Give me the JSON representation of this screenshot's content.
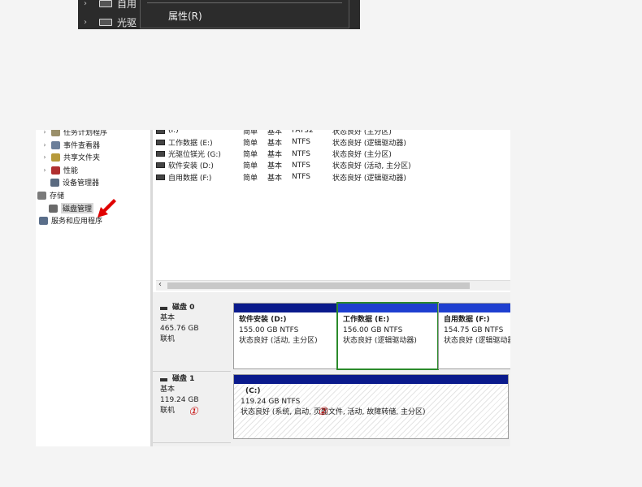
{
  "top_menu": {
    "tree_items": [
      "自用",
      "光驱"
    ],
    "context_menu_item": "属性(R)"
  },
  "nav": {
    "items": [
      {
        "label": "任务计划程序",
        "expander": "›",
        "icon_color": "#9a8f6a"
      },
      {
        "label": "事件查看器",
        "expander": "›",
        "icon_color": "#6b7f9a"
      },
      {
        "label": "共享文件夹",
        "expander": "›",
        "icon_color": "#b79a3a"
      },
      {
        "label": "性能",
        "expander": "›",
        "icon_color": "#b03030"
      },
      {
        "label": "设备管理器",
        "expander": "",
        "icon_color": "#5a6a80"
      },
      {
        "label": "存储",
        "expander": "",
        "icon_color": "#7a7a7a"
      },
      {
        "label": "磁盘管理",
        "expander": "",
        "icon_color": "#6a6a6a"
      },
      {
        "label": "服务和应用程序",
        "expander": "",
        "icon_color": "#5a6e8a"
      }
    ]
  },
  "volumes": [
    {
      "name": "(I:)",
      "layout": "简单",
      "type": "基本",
      "fs": "FAT32",
      "status": "状态良好 (主分区)"
    },
    {
      "name": "工作数据 (E:)",
      "layout": "简单",
      "type": "基本",
      "fs": "NTFS",
      "status": "状态良好 (逻辑驱动器)"
    },
    {
      "name": "光驱位镁光 (G:)",
      "layout": "简单",
      "type": "基本",
      "fs": "NTFS",
      "status": "状态良好 (主分区)"
    },
    {
      "name": "软件安装 (D:)",
      "layout": "简单",
      "type": "基本",
      "fs": "NTFS",
      "status": "状态良好 (活动, 主分区)"
    },
    {
      "name": "自用数据 (F:)",
      "layout": "简单",
      "type": "基本",
      "fs": "NTFS",
      "status": "状态良好 (逻辑驱动器)"
    }
  ],
  "scrollbar": {
    "left_arrow": "‹"
  },
  "disks": [
    {
      "title": "磁盘 0",
      "type": "基本",
      "size": "465.76 GB",
      "state": "联机",
      "partitions": [
        {
          "name": "软件安装 (D:)",
          "size": "155.00 GB NTFS",
          "status": "状态良好 (活动, 主分区)"
        },
        {
          "name": "工作数据 (E:)",
          "size": "156.00 GB NTFS",
          "status": "状态良好 (逻辑驱动器)"
        },
        {
          "name": "自用数据 (F:)",
          "size": "154.75 GB NTFS",
          "status": "状态良好 (逻辑驱动器"
        }
      ]
    },
    {
      "title": "磁盘 1",
      "type": "基本",
      "size": "119.24 GB",
      "state": "联机",
      "partitions": [
        {
          "name": "(C:)",
          "size": "119.24 GB NTFS",
          "status": "状态良好 (系统, 启动, 页面文件, 活动, 故障转储, 主分区)"
        }
      ]
    }
  ],
  "annotations": {
    "marker1": "①",
    "marker2": "②"
  },
  "colors": {
    "primary_bar": "#0a1a8c",
    "logical_bar": "#1e3fd0",
    "selected_border": "#2b8a2b",
    "annotation_red": "#c40000"
  }
}
